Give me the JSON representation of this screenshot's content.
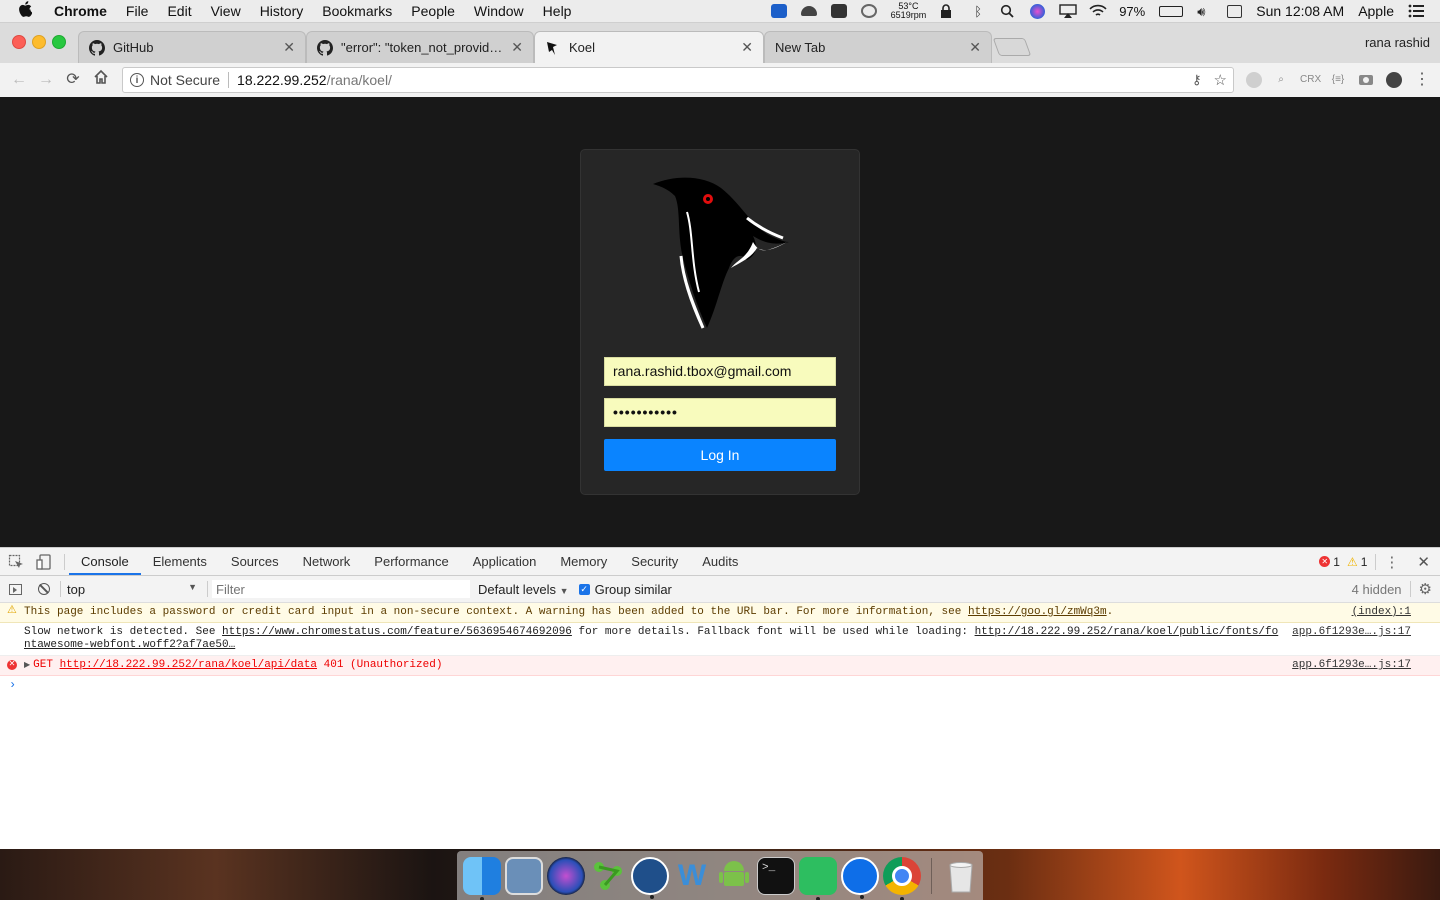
{
  "menubar": {
    "app_name": "Chrome",
    "items": [
      "File",
      "Edit",
      "View",
      "History",
      "Bookmarks",
      "People",
      "Window",
      "Help"
    ],
    "temp": "53°C",
    "fan": "6519rpm",
    "battery": "97%",
    "clock": "Sun 12:08 AM",
    "user": "Apple"
  },
  "tabs": [
    {
      "title": "GitHub",
      "icon": "github-icon"
    },
    {
      "title": "\"error\": \"token_not_provided\"",
      "icon": "github-icon"
    },
    {
      "title": "Koel",
      "icon": "koel-icon",
      "active": true
    },
    {
      "title": "New Tab",
      "icon": ""
    }
  ],
  "profile_name": "rana rashid",
  "address": {
    "security_label": "Not Secure",
    "host": "18.222.99.252",
    "path": "/rana/koel/"
  },
  "login": {
    "email": "rana.rashid.tbox@gmail.com",
    "password_mask": "•••••••••••",
    "button_label": "Log In"
  },
  "devtools": {
    "tabs": [
      "Console",
      "Elements",
      "Sources",
      "Network",
      "Performance",
      "Application",
      "Memory",
      "Security",
      "Audits"
    ],
    "active_tab": "Console",
    "error_count": "1",
    "warning_count": "1",
    "context": "top",
    "filter_placeholder": "Filter",
    "levels": "Default levels",
    "group_similar": "Group similar",
    "hidden": "4 hidden",
    "messages": {
      "warn_text": "This page includes a password or credit card input in a non-secure context. A warning has been added to the URL bar. For more information, see ",
      "warn_link": "https://goo.gl/zmWq3m",
      "warn_tail": ".",
      "warn_src": "(index):1",
      "info_text_1": "Slow network is detected. See ",
      "info_link_1": "https://www.chromestatus.com/feature/5636954674692096",
      "info_text_2": " for more details. Fallback font will be used while loading: ",
      "info_link_2a": "http://18.222.99.252/rana/koel/public/fonts/fo",
      "info_link_2b": "ntawesome-webfont.woff2?af7ae50…",
      "info_src": "app.6f1293e….js:17",
      "err_method": "GET ",
      "err_link": "http://18.222.99.252/rana/koel/api/data",
      "err_status": " 401 (Unauthorized)",
      "err_src": "app.6f1293e….js:17"
    }
  },
  "colors": {
    "accent": "#0a84ff",
    "page_bg": "#181818",
    "card_bg": "#262626",
    "autofill": "#f8fbbd"
  }
}
